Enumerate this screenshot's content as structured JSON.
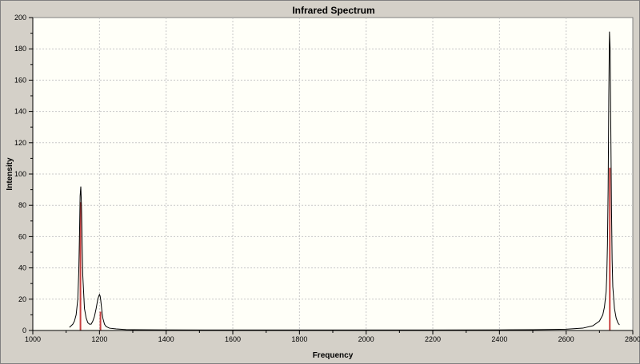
{
  "chart_data": {
    "type": "line",
    "title": "Infrared Spectrum",
    "xlabel": "Frequency",
    "ylabel": "Intensity",
    "xlim": [
      1000,
      2800
    ],
    "ylim": [
      0,
      200
    ],
    "x_ticks": [
      1000,
      1200,
      1400,
      1600,
      1800,
      2000,
      2200,
      2400,
      2600,
      2800
    ],
    "y_ticks": [
      0,
      20,
      40,
      60,
      80,
      100,
      120,
      140,
      160,
      180,
      200
    ],
    "grid": true,
    "series": [
      {
        "kind": "spectrum-curve",
        "color": "#000000",
        "x": [
          1110,
          1115,
          1120,
          1125,
          1130,
          1135,
          1138,
          1140,
          1142,
          1144,
          1146,
          1148,
          1150,
          1155,
          1160,
          1165,
          1170,
          1175,
          1180,
          1185,
          1190,
          1195,
          1198,
          1200,
          1202,
          1204,
          1206,
          1208,
          1210,
          1215,
          1220,
          1230,
          1250,
          1280,
          1300,
          1400,
          1600,
          1800,
          2000,
          2200,
          2400,
          2500,
          2600,
          2650,
          2680,
          2700,
          2710,
          2715,
          2720,
          2722,
          2724,
          2726,
          2728,
          2730,
          2732,
          2734,
          2736,
          2738,
          2740,
          2745,
          2750,
          2755,
          2760
        ],
        "y": [
          2,
          3,
          4,
          6,
          10,
          20,
          38,
          60,
          86,
          92,
          80,
          55,
          35,
          14,
          8,
          5,
          4,
          4,
          6,
          9,
          14,
          20,
          22,
          23,
          22,
          19,
          15,
          11,
          8,
          4,
          2.5,
          1.5,
          1,
          0.6,
          0.5,
          0.4,
          0.3,
          0.3,
          0.3,
          0.3,
          0.4,
          0.5,
          0.8,
          1.5,
          3,
          6,
          10,
          15,
          25,
          35,
          55,
          90,
          150,
          191,
          180,
          130,
          80,
          45,
          28,
          14,
          8,
          5,
          3.5
        ]
      },
      {
        "kind": "stick",
        "color": "#c84040",
        "x": [
          1143,
          1203,
          2731
        ],
        "y": [
          82,
          12,
          104
        ]
      }
    ]
  }
}
